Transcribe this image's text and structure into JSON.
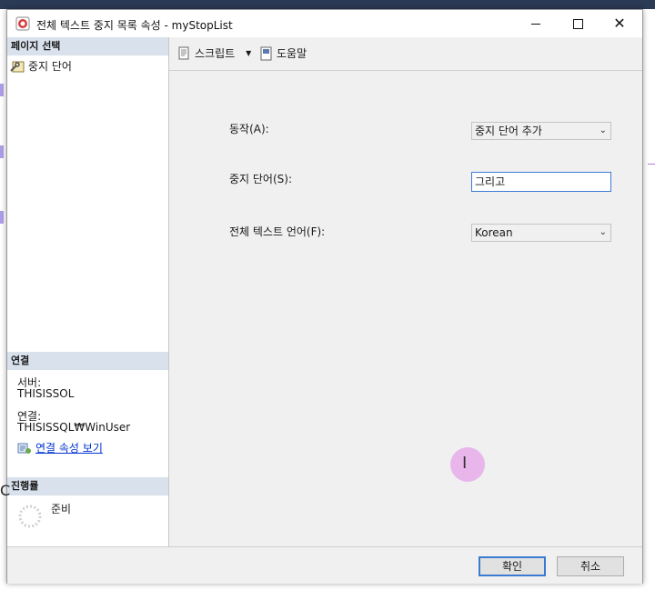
{
  "window": {
    "title": "전체 텍스트 중지 목록 속성 - myStopList",
    "icon": "sql-server-icon"
  },
  "left_pane": {
    "select_page_header": "페이지 선택",
    "pages": [
      {
        "label": "중지 단어",
        "icon": "wrench-page-icon"
      }
    ],
    "connection_header": "연결",
    "server_label": "서버:",
    "server_value": "THISISSOL",
    "connection_label": "연결:",
    "connection_value": "THISISSQL₩WinUser",
    "view_connection_properties": "연결 속성 보기",
    "progress_header": "진행률",
    "progress_status": "준비"
  },
  "toolbar": {
    "script_label": "스크립트",
    "help_label": "도움말"
  },
  "form": {
    "action_label": "동작(A):",
    "action_value": "중지 단어 추가",
    "stopword_label": "중지 단어(S):",
    "stopword_value": "그리고",
    "language_label": "전체 텍스트 언어(F):",
    "language_value": "Korean"
  },
  "footer": {
    "ok_label": "확인",
    "cancel_label": "취소"
  },
  "colors": {
    "section_header_bg": "#d8e1ec",
    "focus_border": "#3c7bd4",
    "link": "#0033cc",
    "cursor_highlight": "#e06ee6"
  }
}
